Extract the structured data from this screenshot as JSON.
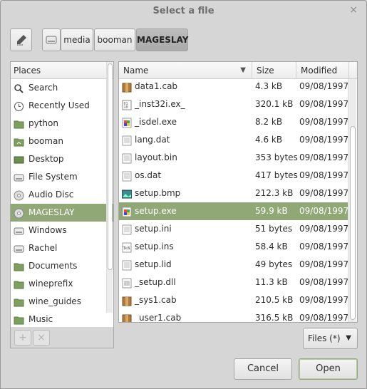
{
  "window": {
    "title": "Select a file",
    "close_glyph": "×"
  },
  "pathbar": {
    "edit_icon": "pencil-icon",
    "drive_icon": "drive-icon",
    "segments": [
      "media",
      "booman",
      "MAGESLAY"
    ],
    "active_segment": "MAGESLAY"
  },
  "places": {
    "header": "Places",
    "items": [
      {
        "label": "Search",
        "icon": "search-icon"
      },
      {
        "label": "Recently Used",
        "icon": "clock-icon"
      },
      {
        "label": "python",
        "icon": "folder-icon"
      },
      {
        "label": "booman",
        "icon": "home-folder-icon"
      },
      {
        "label": "Desktop",
        "icon": "desktop-icon"
      },
      {
        "label": "File System",
        "icon": "drive-icon"
      },
      {
        "label": "Audio Disc",
        "icon": "disc-icon"
      },
      {
        "label": "MAGESLAY",
        "icon": "disc-icon"
      },
      {
        "label": "Windows",
        "icon": "drive-icon"
      },
      {
        "label": "Rachel",
        "icon": "drive-icon"
      },
      {
        "label": "Documents",
        "icon": "folder-icon"
      },
      {
        "label": "wineprefix",
        "icon": "folder-icon"
      },
      {
        "label": "wine_guides",
        "icon": "folder-icon"
      },
      {
        "label": "Music",
        "icon": "folder-icon"
      }
    ],
    "selected": "MAGESLAY",
    "add_glyph": "+",
    "remove_glyph": "×"
  },
  "files": {
    "columns": {
      "name": "Name",
      "size": "Size",
      "modified": "Modified"
    },
    "sort_glyph": "▼",
    "rows": [
      {
        "name": "data1.cab",
        "size": "4.3 kB",
        "modified": "09/08/1997",
        "icon": "cab-icon"
      },
      {
        "name": "_inst32i.ex_",
        "size": "320.1 kB",
        "modified": "09/08/1997",
        "icon": "binary-icon"
      },
      {
        "name": "_isdel.exe",
        "size": "8.2 kB",
        "modified": "09/08/1997",
        "icon": "exe-icon"
      },
      {
        "name": "lang.dat",
        "size": "4.6 kB",
        "modified": "09/08/1997",
        "icon": "text-icon"
      },
      {
        "name": "layout.bin",
        "size": "353 bytes",
        "modified": "09/08/1997",
        "icon": "text-icon"
      },
      {
        "name": "os.dat",
        "size": "417 bytes",
        "modified": "09/08/1997",
        "icon": "text-icon"
      },
      {
        "name": "setup.bmp",
        "size": "212.3 kB",
        "modified": "09/08/1997",
        "icon": "image-icon"
      },
      {
        "name": "setup.exe",
        "size": "59.9 kB",
        "modified": "09/08/1997",
        "icon": "exe-icon"
      },
      {
        "name": "setup.ini",
        "size": "51 bytes",
        "modified": "09/08/1997",
        "icon": "text-icon"
      },
      {
        "name": "setup.ins",
        "size": "58.4 kB",
        "modified": "09/08/1997",
        "icon": "tex-icon"
      },
      {
        "name": "setup.lid",
        "size": "49 bytes",
        "modified": "09/08/1997",
        "icon": "text-icon"
      },
      {
        "name": "_setup.dll",
        "size": "11.3 kB",
        "modified": "09/08/1997",
        "icon": "dll-icon"
      },
      {
        "name": "_sys1.cab",
        "size": "210.5 kB",
        "modified": "09/08/1997",
        "icon": "cab-icon"
      },
      {
        "name": "_user1.cab",
        "size": "316.5 kB",
        "modified": "09/08/1997",
        "icon": "cab-icon"
      }
    ],
    "selected": "setup.exe"
  },
  "filter": {
    "label": "Files (*)",
    "arrow": "▼"
  },
  "buttons": {
    "cancel": "Cancel",
    "open": "Open"
  },
  "colors": {
    "selection": "#8fa876",
    "window_bg": "#d6d6d6"
  }
}
